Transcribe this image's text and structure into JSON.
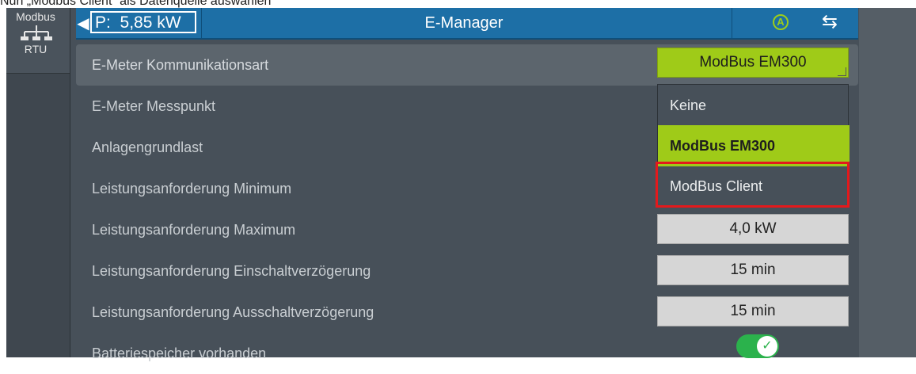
{
  "caption": "Nun „Modbus Client“ als Datenquelle auswählen",
  "sidebar": {
    "tile_top": "Modbus",
    "tile_bottom": "RTU"
  },
  "topbar": {
    "back": "◀",
    "power": "P:  5,85 kW",
    "title": "E-Manager",
    "auto_label": "A",
    "swap_icon": "⇆"
  },
  "rows": [
    {
      "label": "E-Meter Kommunikationsart",
      "value": "ModBus EM300"
    },
    {
      "label": "E-Meter Messpunkt"
    },
    {
      "label": "Anlagengrundlast"
    },
    {
      "label": "Leistungsanforderung Minimum"
    },
    {
      "label": "Leistungsanforderung Maximum",
      "value": "4,0 kW"
    },
    {
      "label": "Leistungsanforderung Einschaltverzögerung",
      "value": "15 min"
    },
    {
      "label": "Leistungsanforderung Ausschaltverzögerung",
      "value": "15 min"
    },
    {
      "label": "Batteriespeicher vorhanden",
      "toggle": true
    }
  ],
  "dropdown": {
    "options": [
      "Keine",
      "ModBus EM300",
      "ModBus Client"
    ],
    "selected": "ModBus EM300",
    "highlighted": "ModBus Client"
  },
  "colors": {
    "accent_green": "#9fcb18",
    "header_blue": "#1d6fa6",
    "highlight_red": "#e3191c",
    "toggle_green": "#2bb24c"
  }
}
